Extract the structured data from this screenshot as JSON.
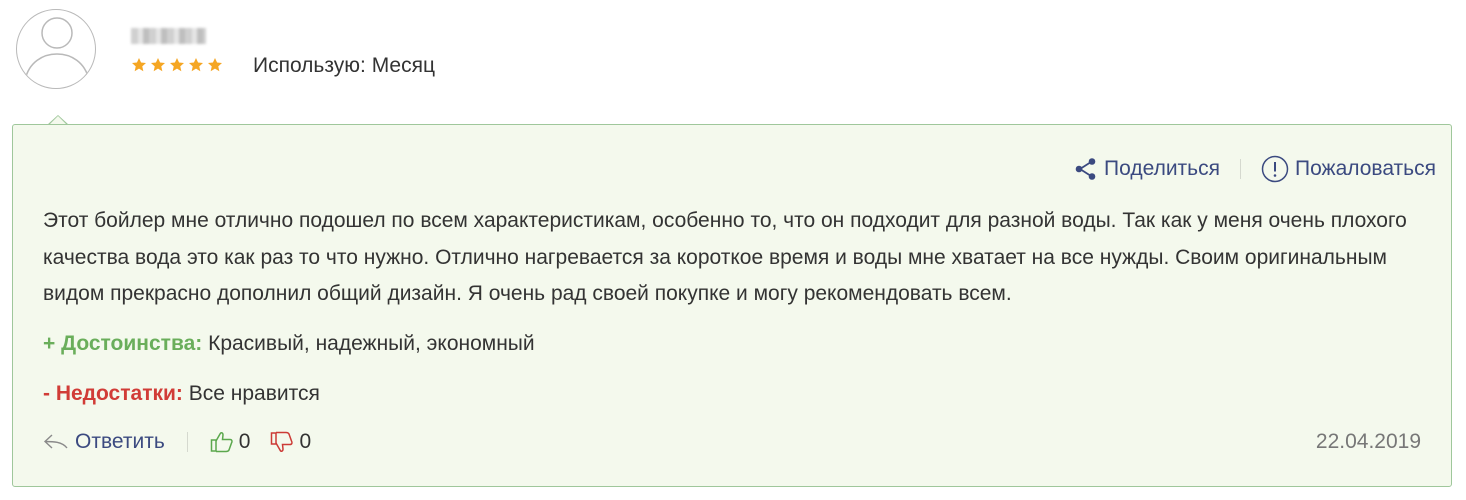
{
  "author": {
    "avatar_icon": "user-avatar-icon",
    "rating": 5,
    "rating_max": 5,
    "usage_text": "Использую: Месяц"
  },
  "review": {
    "text": "Этот бойлер мне отлично подошел по всем характеристикам, особенно то, что он подходит для разной воды. Так как у меня очень плохого качества вода это как раз то что нужно. Отлично нагревается за короткое время и воды мне хватает на все нужды. Своим оригинальным видом прекрасно дополнил общий дизайн. Я очень рад своей покупке и могу рекомендовать всем.",
    "pros_label": "+ Достоинства:",
    "pros_text": "Красивый, надежный, экономный",
    "cons_label": "- Недостатки:",
    "cons_text": "Все нравится",
    "date": "22.04.2019"
  },
  "actions": {
    "share_label": "Поделиться",
    "share_icon": "share-icon",
    "report_label": "Пожаловаться",
    "report_icon": "exclamation-circle-icon",
    "reply_label": "Ответить",
    "reply_icon": "reply-arrow-icon",
    "likes": "0",
    "dislikes": "0"
  },
  "colors": {
    "box_background": "#f4f9ed",
    "box_border": "#9fc79b",
    "link": "#3b4a80",
    "star": "#f5a623",
    "pros": "#6aae5b",
    "cons": "#d13c37",
    "date": "#777777"
  }
}
